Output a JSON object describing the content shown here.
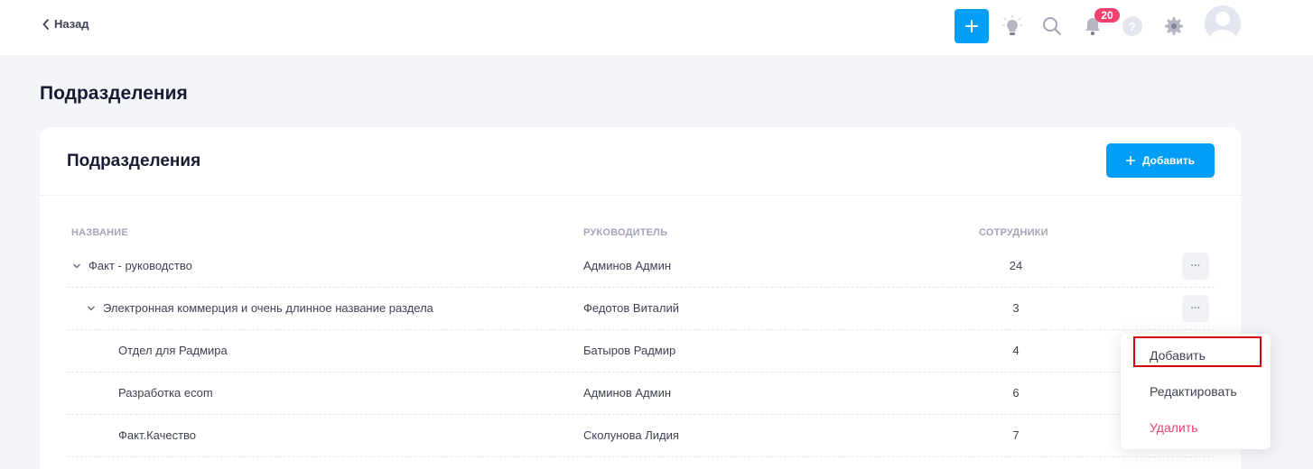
{
  "header": {
    "back_label": "Назад",
    "notification_count": "20",
    "help_label": "?",
    "accent": "#009ef7",
    "badge_color": "#f1416c"
  },
  "page": {
    "title": "Подразделения"
  },
  "card": {
    "title": "Подразделения",
    "add_button_label": "Добавить"
  },
  "table": {
    "columns": [
      "НАЗВАНИЕ",
      "РУКОВОДИТЕЛЬ",
      "СОТРУДНИКИ"
    ],
    "rows": [
      {
        "name": "Факт - руководство",
        "manager": "Админов Админ",
        "count": "24",
        "expandable": true,
        "level": 0,
        "more": "···"
      },
      {
        "name": "Электронная коммерция и очень длинное название раздела",
        "manager": "Федотов Виталий",
        "count": "3",
        "expandable": true,
        "level": 1,
        "more": "···"
      },
      {
        "name": "Отдел для Радмира",
        "manager": "Батыров Радмир",
        "count": "4",
        "expandable": false,
        "level": 2
      },
      {
        "name": "Разработка ecom",
        "manager": "Админов Админ",
        "count": "6",
        "expandable": false,
        "level": 2
      },
      {
        "name": "Факт.Качество",
        "manager": "Сколунова Лидия",
        "count": "7",
        "expandable": false,
        "level": 2
      }
    ]
  },
  "context_menu": {
    "items": [
      {
        "label": "Добавить"
      },
      {
        "label": "Редактировать"
      },
      {
        "label": "Удалить"
      }
    ]
  }
}
